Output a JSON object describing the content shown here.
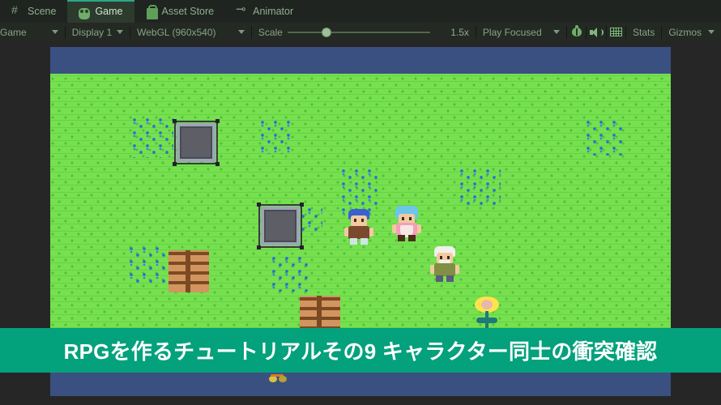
{
  "tabs": [
    {
      "label": "Scene",
      "icon": "hash-grid-icon",
      "active": false
    },
    {
      "label": "Game",
      "icon": "gamepad-icon",
      "active": true
    },
    {
      "label": "Asset Store",
      "icon": "shopping-bag-icon",
      "active": false
    },
    {
      "label": "Animator",
      "icon": "animator-arrow-icon",
      "active": false
    }
  ],
  "toolbar": {
    "view_mode": "Game",
    "display": "Display 1",
    "resolution": "WebGL (960x540)",
    "scale_label": "Scale",
    "scale_value": "1.5x",
    "play_mode": "Play Focused",
    "stats": "Stats",
    "gizmos": "Gizmos",
    "icons": [
      "bug-icon",
      "mute-audio-icon",
      "grid-icon"
    ]
  },
  "game": {
    "sky_color": "#3a5080",
    "ground_color": "#77e04f",
    "characters": [
      {
        "name": "boy-character",
        "hair": "#3a5fd0",
        "shirt": "#7a4a2e",
        "pants": "#cfe4e8",
        "shoes": "#4a2f1c"
      },
      {
        "name": "girl-character",
        "hair": "#6cc6e8",
        "shirt": "#f2a0b8",
        "pants": "#f7e6e6",
        "shoes": "#4a2f1c"
      },
      {
        "name": "old-man-character",
        "hair": "#f0f0ec",
        "shirt": "#7f8f43",
        "pants": "#5a5a7a",
        "shoes": "#3a2a1c"
      }
    ],
    "props": [
      {
        "name": "stone-block",
        "selected": true
      },
      {
        "name": "stone-block",
        "selected": true
      },
      {
        "name": "wooden-crate",
        "selected": false
      },
      {
        "name": "wooden-crate",
        "selected": false
      },
      {
        "name": "flower-prop",
        "selected": false
      },
      {
        "name": "coin-prop",
        "selected": false
      }
    ]
  },
  "caption": {
    "text": "RPGを作るチュートリアルその9 キャラクター同士の衝突確認",
    "background": "#03a17c",
    "color": "#ffffff"
  }
}
